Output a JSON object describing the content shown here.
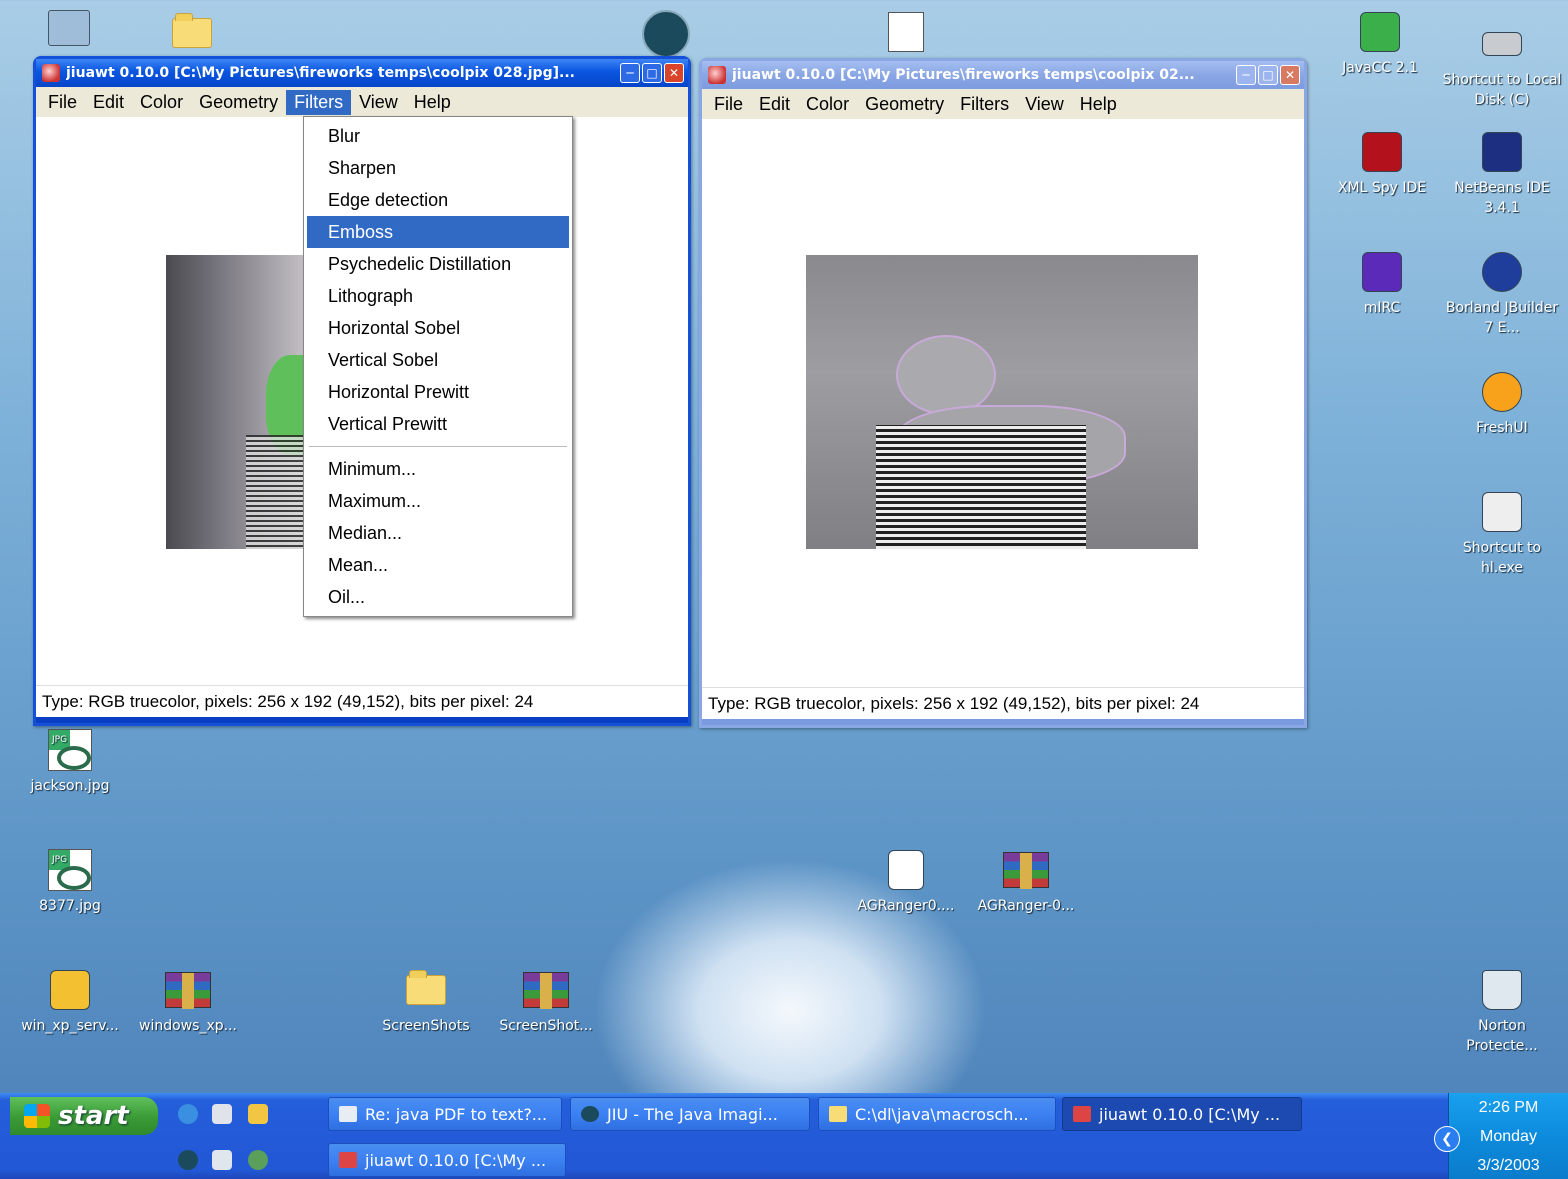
{
  "desktop_icons": [
    {
      "label": "JavaCC 2.1"
    },
    {
      "label": "Shortcut to Local Disk (C)"
    },
    {
      "label": "XML Spy IDE"
    },
    {
      "label": "NetBeans IDE 3.4.1"
    },
    {
      "label": "mIRC"
    },
    {
      "label": "Borland JBuilder 7 E..."
    },
    {
      "label": "FreshUI"
    },
    {
      "label": "Shortcut to hl.exe"
    },
    {
      "label": "jackson.jpg"
    },
    {
      "label": "8377.jpg"
    },
    {
      "label": "AGRanger0...."
    },
    {
      "label": "AGRanger-0..."
    },
    {
      "label": "win_xp_serv..."
    },
    {
      "label": "windows_xp..."
    },
    {
      "label": "ScreenShots"
    },
    {
      "label": "ScreenShot..."
    },
    {
      "label": "Norton Protecte..."
    }
  ],
  "window_left": {
    "title": "jiuawt 0.10.0 [C:\\My Pictures\\fireworks temps\\coolpix 028.jpg]...",
    "menu": [
      "File",
      "Edit",
      "Color",
      "Geometry",
      "Filters",
      "View",
      "Help"
    ],
    "status": "Type: RGB truecolor, pixels: 256 x 192 (49,152), bits per pixel: 24"
  },
  "window_right": {
    "title": "jiuawt 0.10.0 [C:\\My Pictures\\fireworks temps\\coolpix 02...",
    "menu": [
      "File",
      "Edit",
      "Color",
      "Geometry",
      "Filters",
      "View",
      "Help"
    ],
    "status": "Type: RGB truecolor, pixels: 256 x 192 (49,152), bits per pixel: 24"
  },
  "filters_menu": {
    "items": [
      "Blur",
      "Sharpen",
      "Edge detection",
      "Emboss",
      "Psychedelic Distillation",
      "Lithograph",
      "Horizontal Sobel",
      "Vertical Sobel",
      "Horizontal Prewitt",
      "Vertical Prewitt"
    ],
    "items2": [
      "Minimum...",
      "Maximum...",
      "Median...",
      "Mean...",
      "Oil..."
    ],
    "highlighted": "Emboss"
  },
  "taskbar": {
    "start_label": "start",
    "buttons": [
      "Re: java PDF to text?...",
      "JIU - The Java Imagi...",
      "C:\\dl\\java\\macrosch...",
      "jiuawt 0.10.0 [C:\\My ...",
      "jiuawt 0.10.0 [C:\\My ..."
    ],
    "clock_time": "2:26 PM",
    "clock_day": "Monday",
    "clock_date": "3/3/2003"
  },
  "colors": {
    "xp_blue": "#0a55e0",
    "menu_highlight": "#316ac5",
    "start_green": "#3a9a36"
  }
}
